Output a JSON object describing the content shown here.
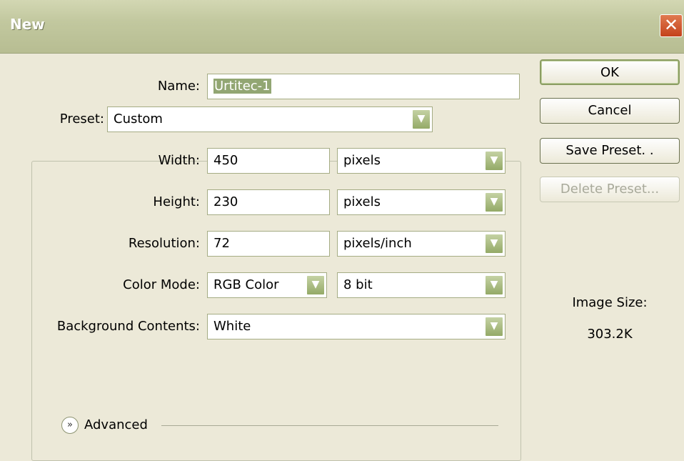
{
  "window": {
    "title": "New"
  },
  "form": {
    "name_label": "Name:",
    "name_value": "Urtitec-1",
    "preset_label": "Preset:",
    "preset_value": "Custom",
    "width_label": "Width:",
    "width_value": "450",
    "width_unit": "pixels",
    "height_label": "Height:",
    "height_value": "230",
    "height_unit": "pixels",
    "resolution_label": "Resolution:",
    "resolution_value": "72",
    "resolution_unit": "pixels/inch",
    "color_mode_label": "Color Mode:",
    "color_mode_value": "RGB Color",
    "bit_depth_value": "8 bit",
    "background_label": "Background Contents:",
    "background_value": "White",
    "advanced_label": "Advanced"
  },
  "buttons": {
    "ok": "OK",
    "cancel": "Cancel",
    "save_preset": "Save Preset. .",
    "delete_preset": "Delete Preset..."
  },
  "image_size": {
    "label": "Image Size:",
    "value": "303.2K"
  },
  "icons": {
    "close": "close-icon",
    "dropdown": "chevron-down-icon",
    "advanced": "double-chevron-down-icon"
  }
}
